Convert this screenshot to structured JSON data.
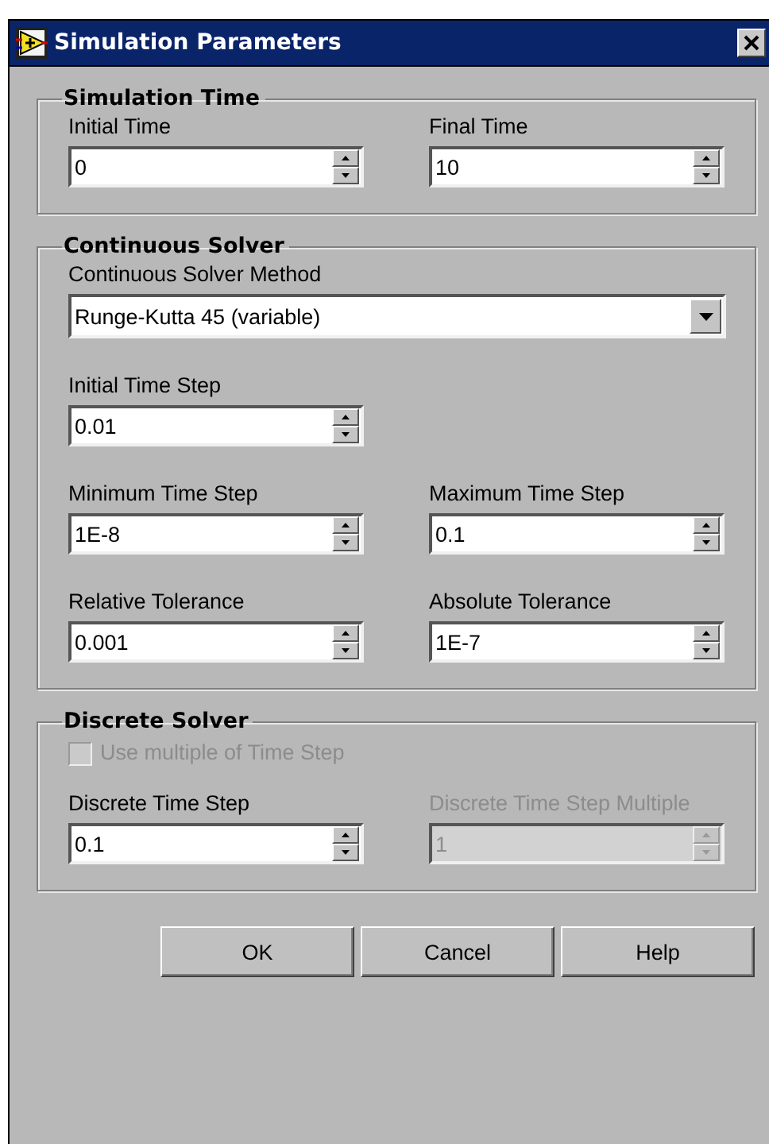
{
  "window": {
    "title": "Simulation Parameters"
  },
  "groups": [
    {
      "title": "Simulation Time",
      "rows": [
        [
          {
            "kind": "spin",
            "label": "Initial Time",
            "value": "0",
            "disabled": false
          },
          {
            "kind": "spin",
            "label": "Final Time",
            "value": "10",
            "disabled": false
          }
        ]
      ]
    },
    {
      "title": "Continuous Solver",
      "rows": [
        [
          {
            "kind": "dropdown",
            "label": "Continuous Solver Method",
            "value": "Runge-Kutta 45 (variable)",
            "disabled": false
          }
        ],
        [
          {
            "kind": "spin",
            "label": "Initial Time Step",
            "value": "0.01",
            "disabled": false
          }
        ],
        [
          {
            "kind": "spin",
            "label": "Minimum Time Step",
            "value": "1E-8",
            "disabled": false
          },
          {
            "kind": "spin",
            "label": "Maximum Time Step",
            "value": "0.1",
            "disabled": false
          }
        ],
        [
          {
            "kind": "spin",
            "label": "Relative Tolerance",
            "value": "0.001",
            "disabled": false
          },
          {
            "kind": "spin",
            "label": "Absolute Tolerance",
            "value": "1E-7",
            "disabled": false
          }
        ]
      ]
    },
    {
      "title": "Discrete Solver",
      "rows": [
        [
          {
            "kind": "checkbox",
            "label": "Use multiple of Time Step",
            "checked": false,
            "disabled": true
          }
        ],
        [
          {
            "kind": "spin",
            "label": "Discrete Time Step",
            "value": "0.1",
            "disabled": false
          },
          {
            "kind": "spin",
            "label": "Discrete Time Step Multiple",
            "value": "1",
            "disabled": true
          }
        ]
      ]
    }
  ],
  "buttons": [
    "OK",
    "Cancel",
    "Help"
  ]
}
